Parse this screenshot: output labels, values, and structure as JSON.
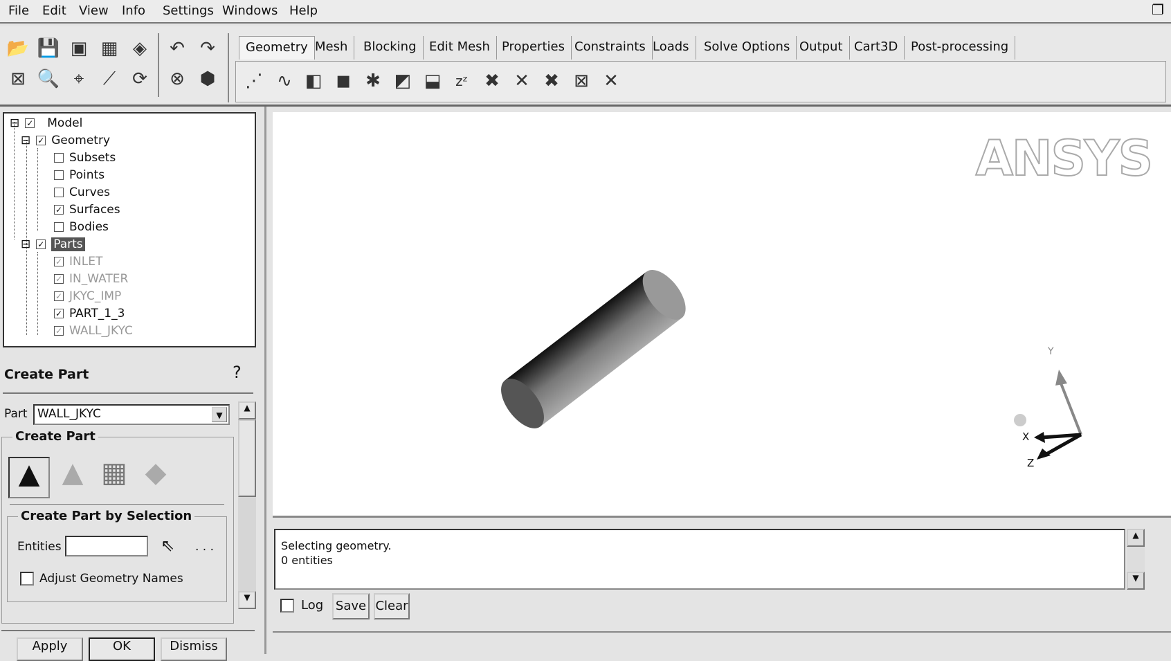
{
  "menu": [
    "File",
    "Edit",
    "View",
    "Info",
    "Settings",
    "Windows",
    "Help"
  ],
  "tabs": [
    "Geometry",
    "Mesh",
    "Blocking",
    "Edit Mesh",
    "Properties",
    "Constraints",
    "Loads",
    "Solve Options",
    "Output",
    "Cart3D",
    "Post-processing"
  ],
  "active_tab": "Geometry",
  "tree": {
    "model": "Model",
    "geometry": "Geometry",
    "geometry_items": [
      {
        "label": "Subsets",
        "checked": false
      },
      {
        "label": "Points",
        "checked": false
      },
      {
        "label": "Curves",
        "checked": false
      },
      {
        "label": "Surfaces",
        "checked": true
      },
      {
        "label": "Bodies",
        "checked": false
      }
    ],
    "parts": "Parts",
    "part_items": [
      "INLET",
      "IN_WATER",
      "JKYC_IMP",
      "PART_1_3",
      "WALL_JKYC"
    ]
  },
  "panel": {
    "title": "Create Part",
    "part_label": "Part",
    "part_value": "WALL_JKYC",
    "group": "Create Part",
    "subgroup": "Create Part by Selection",
    "entities_label": "Entities",
    "entities_value": "",
    "ellipsis": ". . .",
    "adjust_label": "Adjust Geometry Names",
    "apply": "Apply",
    "ok": "OK",
    "dismiss": "Dismiss"
  },
  "viewport": {
    "logo": "ANSYS",
    "axis_y": "Y",
    "axis_x": "X",
    "axis_z": "Z"
  },
  "messages": {
    "line1": "Selecting geometry.",
    "line2": "0 entities",
    "log": "Log",
    "save": "Save",
    "clear": "Clear"
  }
}
